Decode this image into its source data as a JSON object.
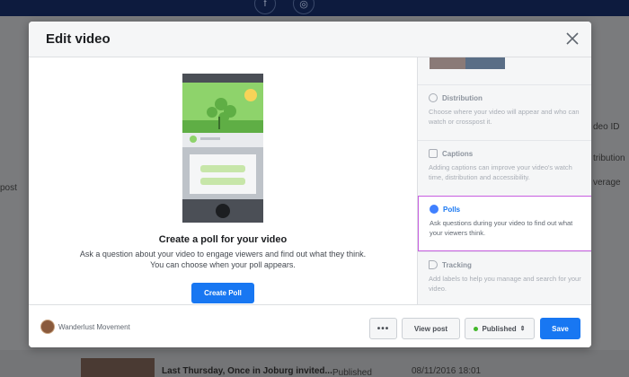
{
  "background": {
    "left_fragment": "post",
    "right_fragments": [
      "deo ID",
      "tribution",
      "verage"
    ],
    "row": {
      "title": "Last Thursday, Once in Joburg invited...",
      "status": "Published",
      "date": "08/11/2016 18:01"
    }
  },
  "modal": {
    "title": "Edit video",
    "close_icon": "close-icon",
    "main": {
      "poll_title": "Create a poll for your video",
      "poll_description": "Ask a question about your video to engage viewers and find out what they think. You can choose when your poll appears.",
      "create_button": "Create Poll"
    },
    "sidebar": {
      "sections": [
        {
          "title": "Distribution",
          "icon": "distribution-icon",
          "desc": "Choose where your video will appear and who can watch or crosspost it."
        },
        {
          "title": "Captions",
          "icon": "captions-icon",
          "desc": "Adding captions can improve your video's watch time, distribution and accessibility."
        },
        {
          "title": "Polls",
          "icon": "poll-icon",
          "desc": "Ask questions during your video to find out what your viewers think.",
          "active": true
        },
        {
          "title": "Tracking",
          "icon": "tag-icon",
          "desc": "Add labels to help you manage and search for your video."
        }
      ]
    },
    "footer": {
      "page_name": "Wanderlust Movement",
      "more_label": "•••",
      "view_post_label": "View post",
      "published_label": "Published",
      "published_arrow": "⇕",
      "save_label": "Save"
    }
  },
  "colors": {
    "accent": "#1877f2",
    "active_border": "#c75ee0",
    "published_dot": "#42b72a"
  }
}
